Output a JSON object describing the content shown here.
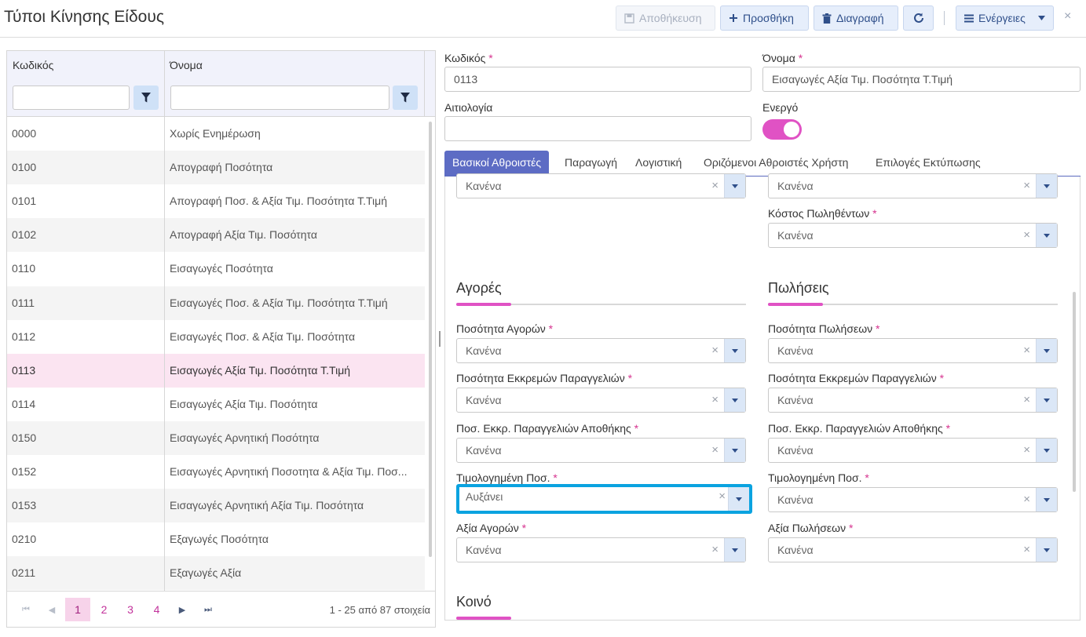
{
  "header": {
    "title": "Τύποι Κίνησης Είδους",
    "save_label": "Αποθήκευση",
    "add_label": "Προσθήκη",
    "delete_label": "Διαγραφή",
    "actions_label": "Ενέργειες",
    "close_glyph": "×"
  },
  "grid": {
    "col_code": "Κωδικός",
    "col_name": "Όνομα",
    "rows": [
      {
        "code": "0000",
        "name": "Χωρίς Ενημέρωση"
      },
      {
        "code": "0100",
        "name": "Απογραφή Ποσότητα"
      },
      {
        "code": "0101",
        "name": "Απογραφή Ποσ. & Αξία Τιμ. Ποσότητα Τ.Τιμή"
      },
      {
        "code": "0102",
        "name": "Απογραφή Αξία Τιμ. Ποσότητα"
      },
      {
        "code": "0110",
        "name": "Εισαγωγές Ποσότητα"
      },
      {
        "code": "0111",
        "name": "Εισαγωγές Ποσ. & Αξία Τιμ. Ποσότητα Τ.Τιμή"
      },
      {
        "code": "0112",
        "name": "Εισαγωγές Ποσ. & Αξία Τιμ. Ποσότητα"
      },
      {
        "code": "0113",
        "name": "Εισαγωγές Αξία Τιμ. Ποσότητα Τ.Τιμή"
      },
      {
        "code": "0114",
        "name": "Εισαγωγές Αξία Τιμ. Ποσότητα"
      },
      {
        "code": "0150",
        "name": "Εισαγωγές Αρνητική Ποσότητα"
      },
      {
        "code": "0152",
        "name": "Εισαγωγές Αρνητική Ποσοτητα & Αξία Τιμ. Ποσ..."
      },
      {
        "code": "0153",
        "name": "Εισαγωγές Αρνητική Αξία Τιμ. Ποσότητα"
      },
      {
        "code": "0210",
        "name": "Εξαγωγές Ποσότητα"
      },
      {
        "code": "0211",
        "name": "Εξαγωγές Αξία"
      }
    ],
    "selected_code": "0113",
    "pager": {
      "pages": [
        "1",
        "2",
        "3",
        "4"
      ],
      "active_page": "1",
      "first": "⏮",
      "prev": "◀",
      "next": "▶",
      "last": "⏭",
      "info": "1 - 25 από 87 στοιχεία"
    }
  },
  "form": {
    "code_label": "Κωδικός",
    "code_value": "0113",
    "name_label": "Όνομα",
    "name_value": "Εισαγωγές Αξία Τιμ. Ποσότητα Τ.Τιμή",
    "reason_label": "Αιτιολογία",
    "reason_value": "",
    "active_label": "Ενεργό",
    "active": true,
    "required_mark": "*",
    "tabs": [
      "Βασικοί Αθροιστές",
      "Παραγωγή",
      "Λογιστική",
      "Οριζόμενοι Αθροιστές Χρήστη",
      "Επιλογές Εκτύπωσης"
    ],
    "active_tab": "Βασικοί Αθροιστές"
  },
  "panel": {
    "top_left_value": "Κανένα",
    "top_right_value": "Κανένα",
    "cost_label": "Κόστος Πωληθέντων",
    "cost_value": "Κανένα",
    "purchases_title": "Αγορές",
    "sales_title": "Πωλήσεις",
    "common_title": "Κοινό",
    "purchases": [
      {
        "label": "Ποσότητα Αγορών",
        "value": "Κανένα"
      },
      {
        "label": "Ποσότητα Εκκρεμών Παραγγελιών",
        "value": "Κανένα"
      },
      {
        "label": "Ποσ. Εκκρ. Παραγγελιών Αποθήκης",
        "value": "Κανένα"
      },
      {
        "label": "Τιμολογημένη Ποσ.",
        "value": "Αυξάνει"
      },
      {
        "label": "Αξία Αγορών",
        "value": "Κανένα"
      }
    ],
    "sales": [
      {
        "label": "Ποσότητα Πωλήσεων",
        "value": "Κανένα"
      },
      {
        "label": "Ποσότητα Εκκρεμών Παραγγελιών",
        "value": "Κανένα"
      },
      {
        "label": "Ποσ. Εκκρ. Παραγγελιών Αποθήκης",
        "value": "Κανένα"
      },
      {
        "label": "Τιμολογημένη Ποσ.",
        "value": "Κανένα"
      },
      {
        "label": "Αξία Πωλήσεων",
        "value": "Κανένα"
      }
    ],
    "clear_glyph": "×"
  },
  "colors": {
    "accent": "#e052c4",
    "tab_active": "#5d6cc4",
    "focus": "#0aa3e0",
    "selected_row": "#fbe4f1"
  }
}
